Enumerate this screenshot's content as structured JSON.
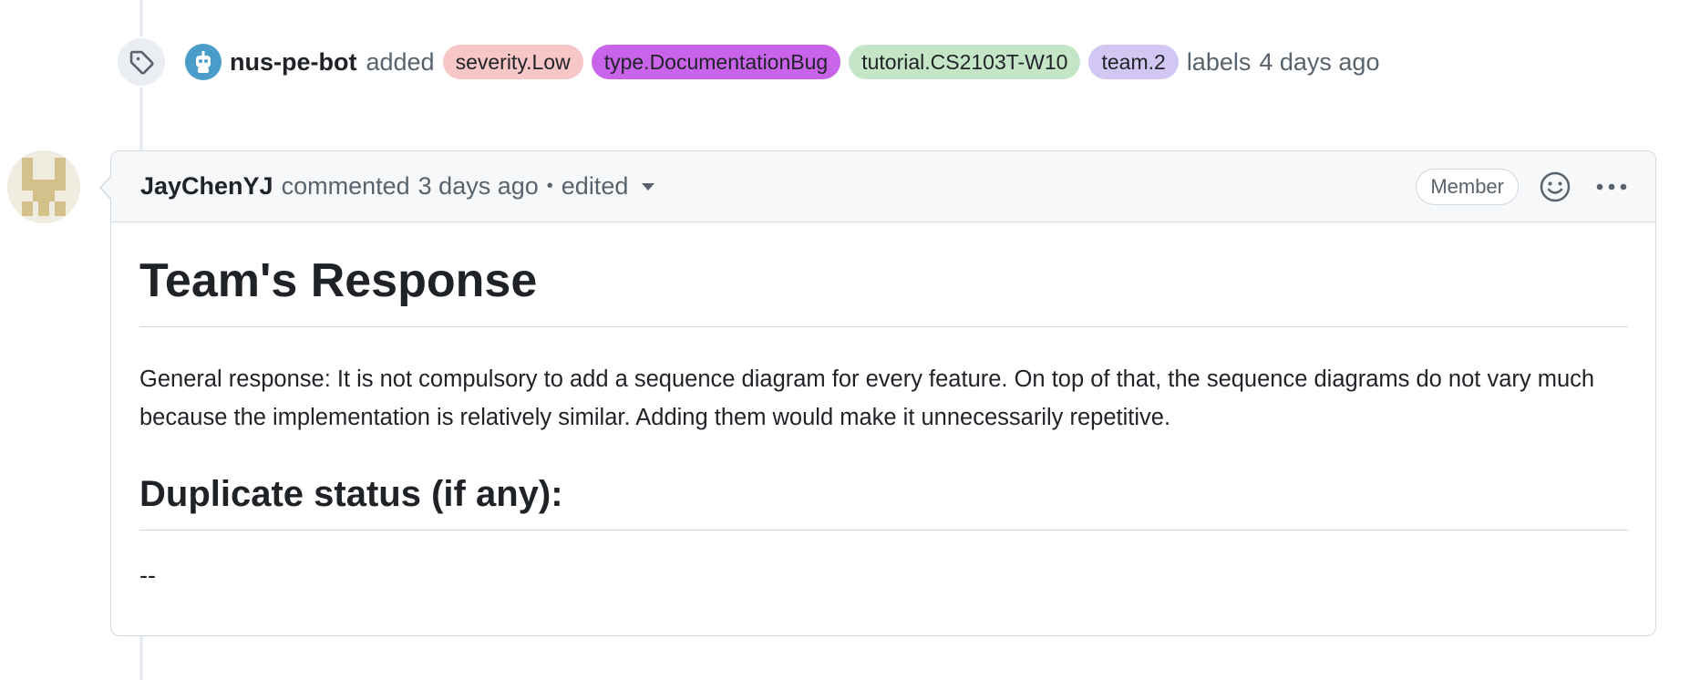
{
  "label_event": {
    "actor": "nus-pe-bot",
    "action": "added",
    "labels": [
      {
        "text": "severity.Low",
        "color": "#f7c6c7"
      },
      {
        "text": "type.DocumentationBug",
        "color": "#c964ea"
      },
      {
        "text": "tutorial.CS2103T-W10",
        "color": "#c5e5c7"
      },
      {
        "text": "team.2",
        "color": "#d2c7f2"
      }
    ],
    "suffix": "labels",
    "time": "4 days ago",
    "icon": "tag-icon"
  },
  "comment": {
    "author": "JayChenYJ",
    "verb": "commented",
    "time": "3 days ago",
    "separator": "•",
    "edited": "edited",
    "role_badge": "Member",
    "heading": "Team's Response",
    "response": "General response: It is not compulsory to add a sequence diagram for every feature. On top of that, the sequence diagrams do not vary much because the implementation is relatively similar. Adding them would make it unnecessarily repetitive.",
    "subheading": "Duplicate status (if any):",
    "duplicate_value": "--"
  },
  "colors": {
    "text_primary": "#1f2328",
    "text_muted": "#59636e",
    "border": "#d1d9e0",
    "header_bg": "#f6f8fa",
    "bot_avatar": "#4a9cc9",
    "identicon": "#d4c08a"
  }
}
